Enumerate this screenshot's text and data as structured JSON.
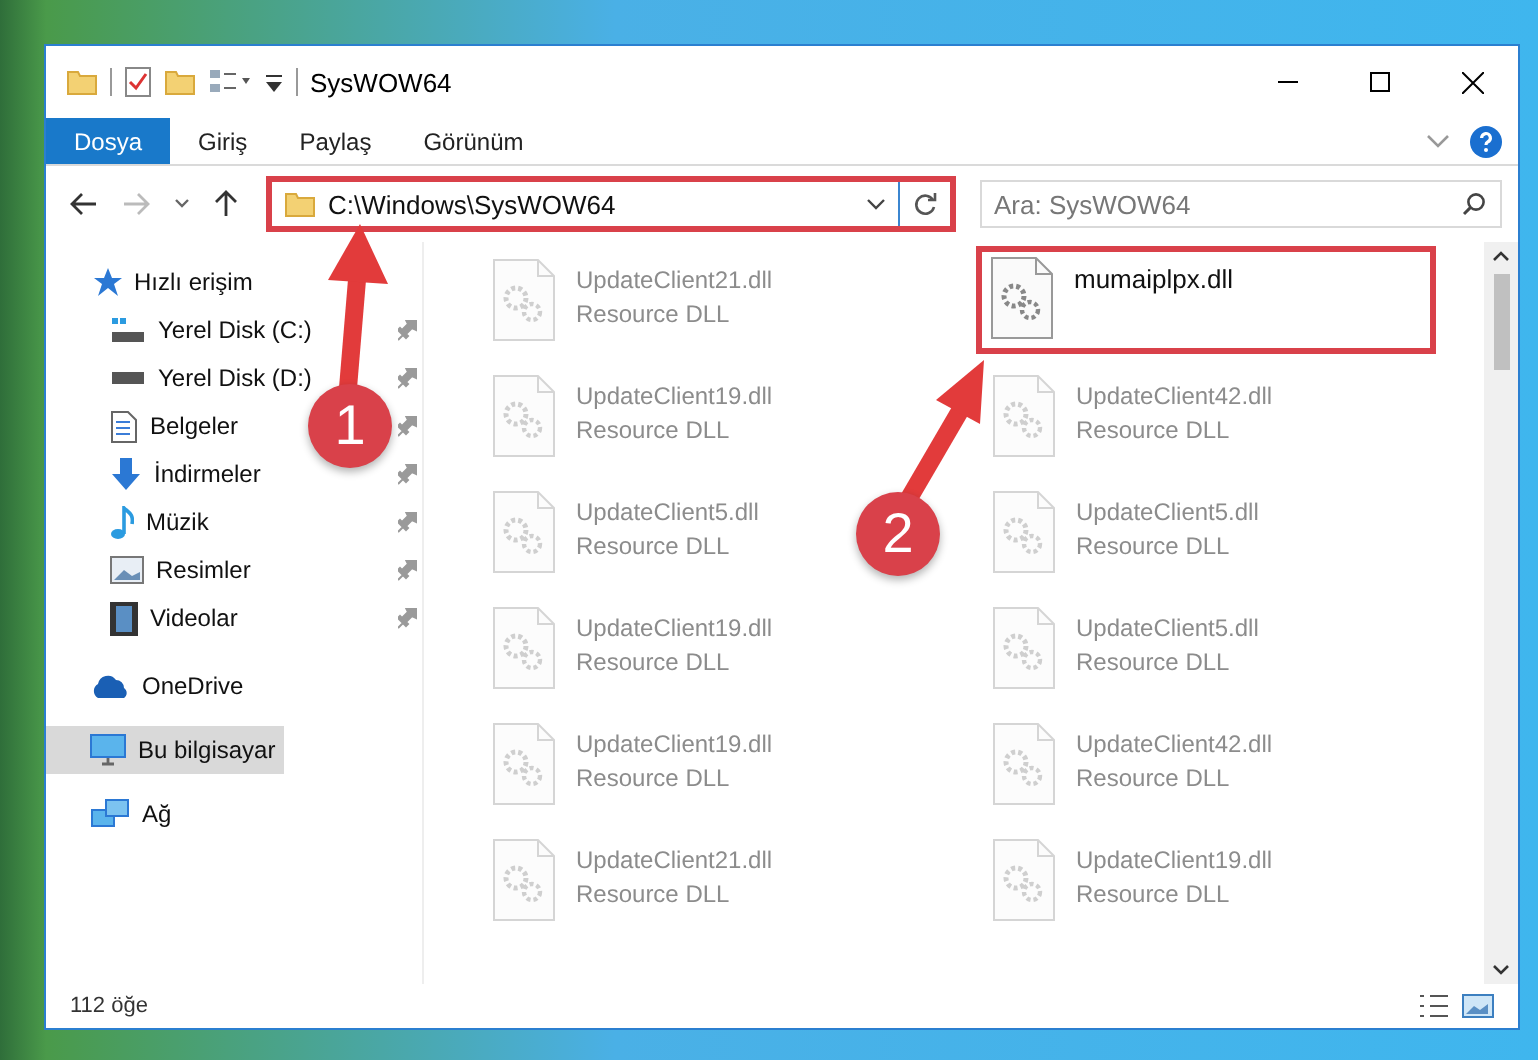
{
  "window": {
    "title": "SysWOW64"
  },
  "tabs": [
    {
      "label": "Dosya",
      "selected": true
    },
    {
      "label": "Giriş",
      "selected": false
    },
    {
      "label": "Paylaş",
      "selected": false
    },
    {
      "label": "Görünüm",
      "selected": false
    }
  ],
  "address": {
    "path": "C:\\Windows\\SysWOW64",
    "highlighted": true
  },
  "search": {
    "placeholder": "Ara: SysWOW64"
  },
  "sidebar": {
    "items": [
      {
        "label": "Hızlı erişim",
        "kind": "star",
        "group": true,
        "selected": false
      },
      {
        "label": "Yerel Disk (C:)",
        "kind": "drive-win",
        "group": false,
        "pinned": true,
        "selected": false
      },
      {
        "label": "Yerel Disk (D:)",
        "kind": "drive",
        "group": false,
        "pinned": true,
        "selected": false
      },
      {
        "label": "Belgeler",
        "kind": "doc",
        "group": false,
        "pinned": true,
        "selected": false
      },
      {
        "label": "İndirmeler",
        "kind": "download",
        "group": false,
        "pinned": true,
        "selected": false
      },
      {
        "label": "Müzik",
        "kind": "music",
        "group": false,
        "pinned": true,
        "selected": false
      },
      {
        "label": "Resimler",
        "kind": "picture",
        "group": false,
        "pinned": true,
        "selected": false
      },
      {
        "label": "Videolar",
        "kind": "video",
        "group": false,
        "pinned": true,
        "selected": false
      },
      {
        "label": "OneDrive",
        "kind": "cloud",
        "group": true,
        "selected": false
      },
      {
        "label": "Bu bilgisayar",
        "kind": "pc",
        "group": true,
        "selected": true
      },
      {
        "label": "Ağ",
        "kind": "network",
        "group": true,
        "selected": false
      }
    ]
  },
  "files": [
    {
      "name": "UpdateClient21.dll",
      "type": "Resource DLL",
      "blurred": true,
      "highlighted": false
    },
    {
      "name": "mumaiplpx.dll",
      "blurred": false,
      "highlighted": true
    },
    {
      "name": "UpdateClient19.dll",
      "type": "Resource DLL",
      "blurred": true,
      "highlighted": false
    },
    {
      "name": "UpdateClient42.dll",
      "type": "Resource DLL",
      "blurred": true,
      "highlighted": false
    },
    {
      "name": "UpdateClient5.dll",
      "type": "Resource DLL",
      "blurred": true,
      "highlighted": false
    },
    {
      "name": "UpdateClient5.dll",
      "type": "Resource DLL",
      "blurred": true,
      "highlighted": false
    },
    {
      "name": "UpdateClient19.dll",
      "type": "Resource DLL",
      "blurred": true,
      "highlighted": false
    },
    {
      "name": "UpdateClient5.dll",
      "type": "Resource DLL",
      "blurred": true,
      "highlighted": false
    },
    {
      "name": "UpdateClient19.dll",
      "type": "Resource DLL",
      "blurred": true,
      "highlighted": false
    },
    {
      "name": "UpdateClient42.dll",
      "type": "Resource DLL",
      "blurred": true,
      "highlighted": false
    },
    {
      "name": "UpdateClient21.dll",
      "type": "Resource DLL",
      "blurred": true,
      "highlighted": false
    },
    {
      "name": "UpdateClient19.dll",
      "type": "Resource DLL",
      "blurred": true,
      "highlighted": false
    }
  ],
  "status_bar": {
    "count": "112 öğe"
  },
  "annotations": [
    {
      "label": "1"
    },
    {
      "label": "2"
    }
  ]
}
